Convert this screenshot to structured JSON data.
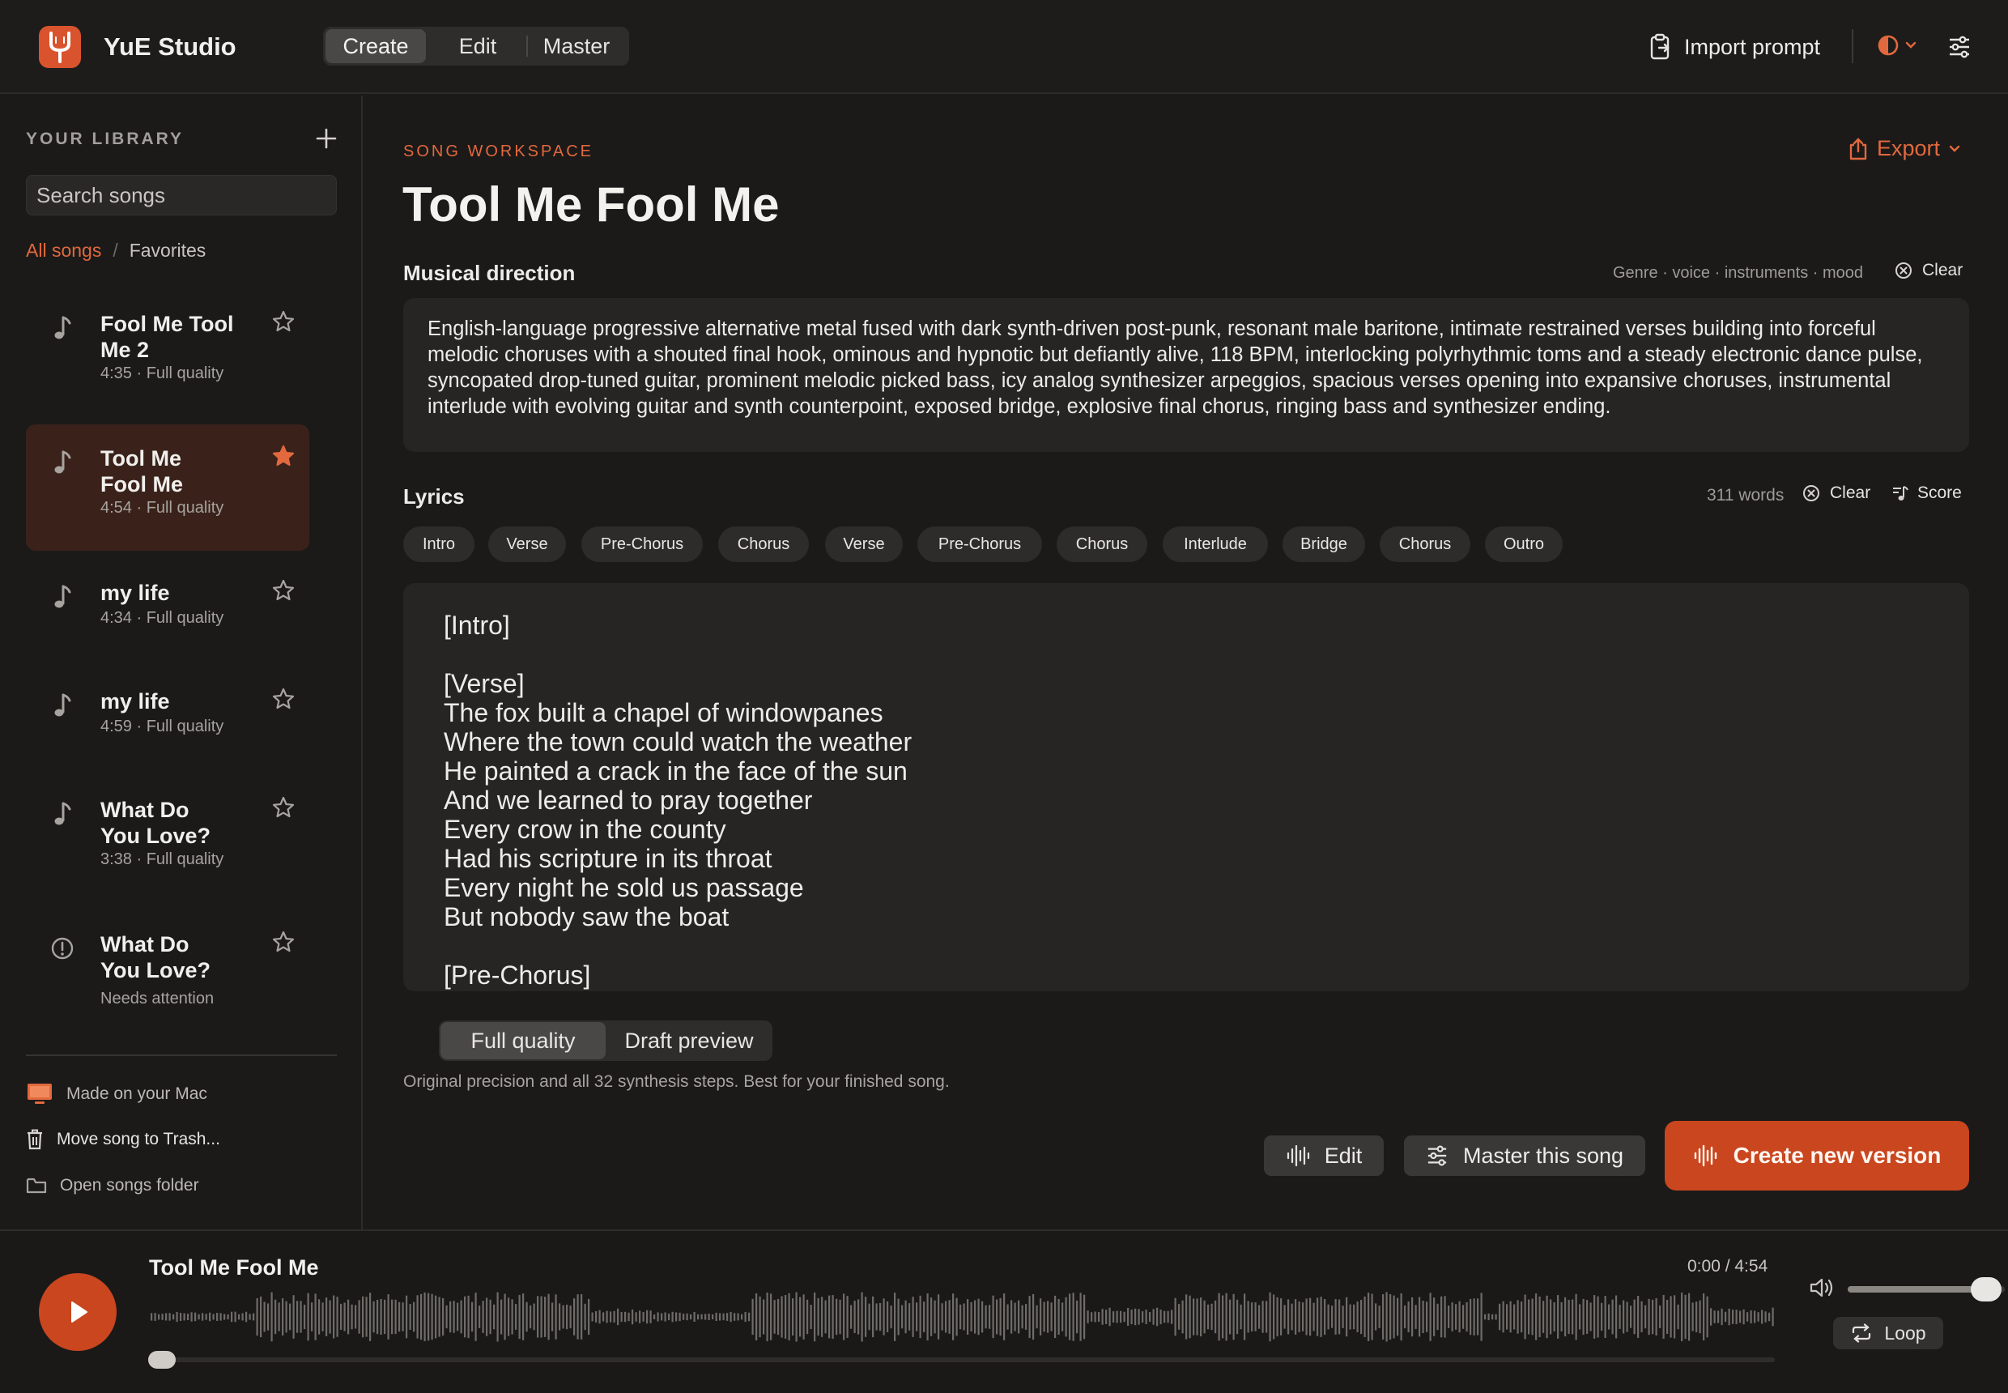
{
  "app": {
    "title": "YuE Studio",
    "accent_color": "#d9542e",
    "tabs": [
      {
        "label": "Create",
        "active": true
      },
      {
        "label": "Edit",
        "active": false
      },
      {
        "label": "Master",
        "active": false
      }
    ],
    "import_label": "Import prompt",
    "icons": {
      "logo": "tuning-fork-icon",
      "import": "clipboard-icon",
      "theme": "contrast-icon",
      "settings": "sliders-icon"
    }
  },
  "sidebar": {
    "heading": "YOUR LIBRARY",
    "search_placeholder": "Search songs",
    "filters": {
      "all": "All songs",
      "separator": "/",
      "favorites": "Favorites"
    },
    "songs": [
      {
        "title": "Fool Me Tool Me 2",
        "meta": "4:35 · Full quality",
        "favorite": false,
        "selected": false,
        "icon": "music-note-icon"
      },
      {
        "title": "Tool Me Fool Me",
        "meta": "4:54 · Full quality",
        "favorite": true,
        "selected": true,
        "icon": "music-note-icon"
      },
      {
        "title": "my life",
        "meta": "4:34 · Full quality",
        "favorite": false,
        "selected": false,
        "icon": "music-note-icon"
      },
      {
        "title": "my life",
        "meta": "4:59 · Full quality",
        "favorite": false,
        "selected": false,
        "icon": "music-note-icon"
      },
      {
        "title": "What Do You Love?",
        "meta": "3:38 · Full quality",
        "favorite": false,
        "selected": false,
        "icon": "music-note-icon"
      },
      {
        "title": "What Do You Love?",
        "meta": "Needs attention",
        "favorite": false,
        "selected": false,
        "icon": "alert-circle-icon"
      }
    ],
    "footer": {
      "made_on": "Made on your Mac",
      "trash": "Move song to Trash...",
      "folder": "Open songs folder"
    }
  },
  "main": {
    "workspace_label": "SONG WORKSPACE",
    "song_title": "Tool Me Fool Me",
    "export_label": "Export",
    "direction": {
      "label": "Musical direction",
      "hint": "Genre · voice · instruments · mood",
      "clear_label": "Clear",
      "text": "English-language progressive alternative metal fused with dark synth-driven post-punk, resonant male baritone, intimate restrained verses building into forceful melodic choruses with a shouted final hook, ominous and hypnotic but defiantly alive, 118 BPM, interlocking polyrhythmic toms and a steady electronic dance pulse, syncopated drop-tuned guitar, prominent melodic picked bass, icy analog synthesizer arpeggios, spacious verses opening into expansive choruses, instrumental interlude with evolving guitar and synth counterpoint, exposed bridge, explosive final chorus, ringing bass and synthesizer ending."
    },
    "lyrics": {
      "label": "Lyrics",
      "word_count": "311 words",
      "clear_label": "Clear",
      "score_label": "Score",
      "sections": [
        "Intro",
        "Verse",
        "Pre-Chorus",
        "Chorus",
        "Verse",
        "Pre-Chorus",
        "Chorus",
        "Interlude",
        "Bridge",
        "Chorus",
        "Outro"
      ],
      "text": "[Intro]\n\n[Verse]\nThe fox built a chapel of windowpanes\nWhere the town could watch the weather\nHe painted a crack in the face of the sun\nAnd we learned to pray together\nEvery crow in the county\nHad his scripture in its throat\nEvery night he sold us passage\nBut nobody saw the boat\n\n[Pre-Chorus]"
    },
    "quality": {
      "options": [
        {
          "label": "Full quality",
          "active": true
        },
        {
          "label": "Draft preview",
          "active": false
        }
      ],
      "description": "Original precision and all 32 synthesis steps. Best for your finished song."
    },
    "actions": {
      "edit": "Edit",
      "master": "Master this song",
      "create": "Create new version"
    }
  },
  "player": {
    "title": "Tool Me Fool Me",
    "time": "0:00 / 4:54",
    "progress": 0,
    "volume": 0.88,
    "loop_label": "Loop"
  }
}
